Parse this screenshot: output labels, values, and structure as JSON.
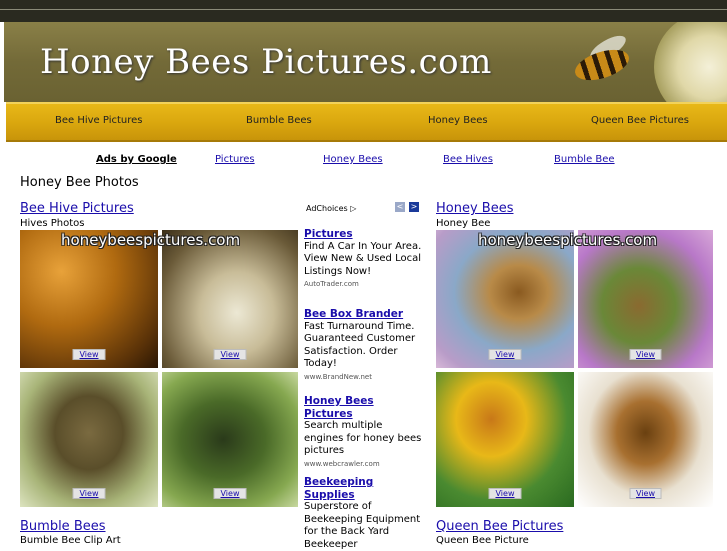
{
  "site": {
    "title": "Honey Bees Pictures.com"
  },
  "nav": [
    "Bee Hive Pictures",
    "Bumble Bees",
    "Honey Bees",
    "Queen Bee Pictures"
  ],
  "ads_bar": {
    "label": "Ads by Google",
    "links": [
      "Pictures",
      "Honey Bees",
      "Bee Hives",
      "Bumble Bee"
    ]
  },
  "page_title": "Honey Bee Photos",
  "sections": {
    "hive": {
      "title": "Bee Hive Pictures",
      "subtitle": "Hives Photos"
    },
    "bumble": {
      "title": "Bumble Bees",
      "subtitle": "Bumble Bee Clip Art"
    },
    "honey": {
      "title": "Honey Bees",
      "subtitle": "Honey Bee"
    },
    "queen": {
      "title": "Queen Bee Pictures",
      "subtitle": "Queen Bee Picture"
    }
  },
  "watermark": "honeybeespictures.com",
  "view_label": "View",
  "adchoices": {
    "label": "AdChoices",
    "prev": "<",
    "next": ">"
  },
  "ads": [
    {
      "title": "Pictures",
      "body": "Find A Car In Your Area. View New & Used Local Listings Now!",
      "url": "AutoTrader.com"
    },
    {
      "title": "Bee Box Brander",
      "body": "Fast Turnaround Time. Guaranteed Customer Satisfaction. Order Today!",
      "url": "www.BrandNew.net"
    },
    {
      "title": "Honey Bees Pictures",
      "body": "Search multiple engines for honey bees pictures",
      "url": "www.webcrawler.com"
    },
    {
      "title": "Beekeeping Supplies",
      "body": "Superstore of Beekeeping Equipment for the Back Yard Beekeeper",
      "url": ""
    }
  ],
  "colors": {
    "nav_bg": "#d9a60e",
    "link": "#1a0dab",
    "banner": "#7a7240"
  }
}
